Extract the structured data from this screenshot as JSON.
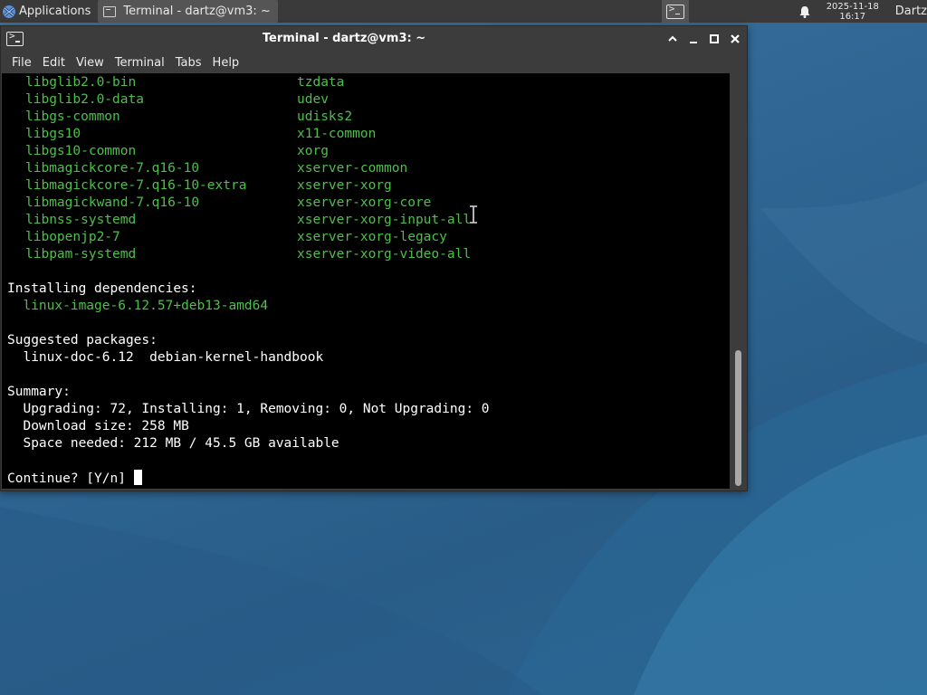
{
  "panel": {
    "applications_label": "Applications",
    "task_label": "Terminal - dartz@vm3: ~",
    "clock_date": "2025-11-18",
    "clock_time": "16:17",
    "user_label": "Dartz"
  },
  "window": {
    "title": "Terminal - dartz@vm3: ~",
    "menu": [
      "File",
      "Edit",
      "View",
      "Terminal",
      "Tabs",
      "Help"
    ]
  },
  "terminal": {
    "packages_col1": [
      "libglib2.0-bin",
      "libglib2.0-data",
      "libgs-common",
      "libgs10",
      "libgs10-common",
      "libmagickcore-7.q16-10",
      "libmagickcore-7.q16-10-extra",
      "libmagickwand-7.q16-10",
      "libnss-systemd",
      "libopenjp2-7",
      "libpam-systemd"
    ],
    "packages_col2": [
      "tzdata",
      "udev",
      "udisks2",
      "x11-common",
      "xorg",
      "xserver-common",
      "xserver-xorg",
      "xserver-xorg-core",
      "xserver-xorg-input-all",
      "xserver-xorg-legacy",
      "xserver-xorg-video-all"
    ],
    "installing_header": "Installing dependencies:",
    "installing_pkg": "linux-image-6.12.57+deb13-amd64",
    "suggested_header": "Suggested packages:",
    "suggested_pkgs": "linux-doc-6.12  debian-kernel-handbook",
    "summary_header": "Summary:",
    "summary_counts": "Upgrading: 72, Installing: 1, Removing: 0, Not Upgrading: 0",
    "download_size": "Download size: 258 MB",
    "space_needed": "Space needed: 212 MB / 45.5 GB available",
    "prompt": "Continue? [Y/n] "
  },
  "colors": {
    "terminal_bg": "#000000",
    "package_green": "#4ebf4b",
    "window_chrome": "#3c3c3c",
    "panel_bg": "#3a3a3a",
    "desktop": "#2e6591"
  }
}
